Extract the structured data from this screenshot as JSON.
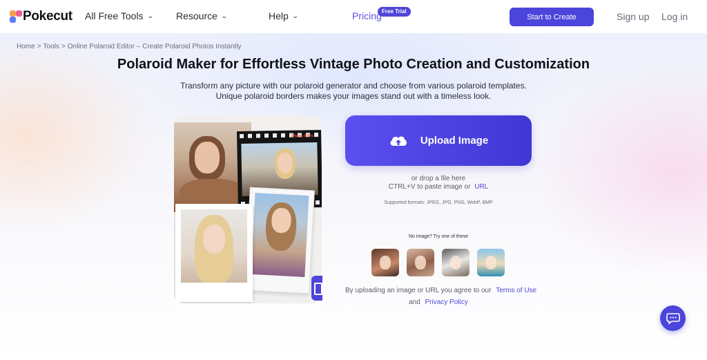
{
  "header": {
    "brand": "Pokecut",
    "nav": [
      {
        "label": "All Free Tools",
        "has_dropdown": true
      },
      {
        "label": "Resource",
        "has_dropdown": true
      },
      {
        "label": "Help",
        "has_dropdown": true
      },
      {
        "label": "Pricing",
        "has_dropdown": false
      }
    ],
    "pricing_badge": "Free Trial",
    "start_button": "Start to Create",
    "sign_up": "Sign up",
    "log_in": "Log in"
  },
  "breadcrumb": [
    "Home",
    "Tools",
    "Online Polaroid Editor – Create Polaroid Photos Instantly"
  ],
  "breadcrumb_separator": ">",
  "page_title": "Polaroid Maker for Effortless Vintage Photo Creation and Customization",
  "subtitle_lines": [
    "Transform any picture with our polaroid generator and choose from various polaroid templates.",
    "Unique polaroid borders makes your images stand out with a timeless look."
  ],
  "collage": {
    "film_label": "Photo Film"
  },
  "upload": {
    "button_label": "Upload Image",
    "drop_hint": "or drop a file here",
    "paste_hint": "CTRL+V to paste image or",
    "url_link": "URL",
    "formats": "Supported formats: JPEG, JPG, PNG, WebP, BMP"
  },
  "samples": {
    "prompt": "No image? Try one of these",
    "count": 4
  },
  "terms": {
    "line1": "By uploading an image or URL you agree to our",
    "terms_link": "Terms of Use",
    "and": "and",
    "privacy_link": "Privacy Policy"
  },
  "colors": {
    "accent": "#4b45db",
    "link": "#4f46d8"
  },
  "icons": [
    "cloud-upload-icon",
    "chevron-down-icon",
    "chat-icon"
  ]
}
